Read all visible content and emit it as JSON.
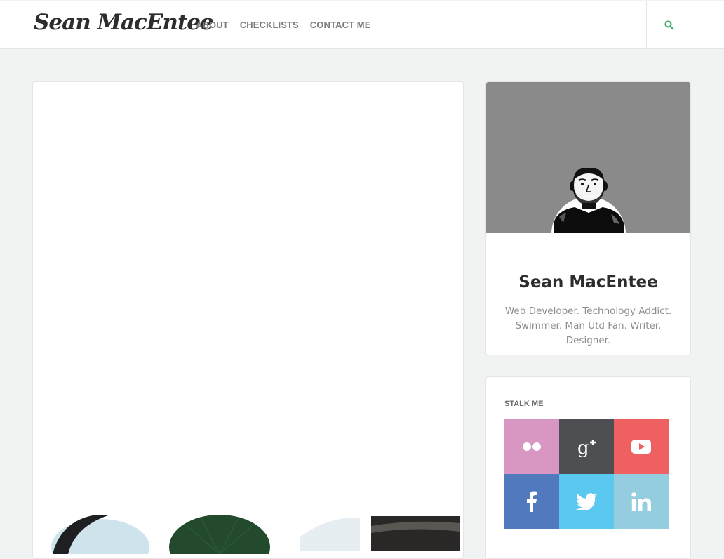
{
  "header": {
    "logo": "Sean MacEntee",
    "nav": [
      "ABOUT",
      "CHECKLISTS",
      "CONTACT ME"
    ],
    "search_icon": "search-icon"
  },
  "profile": {
    "name": "Sean MacEntee",
    "bio": "Web Developer. Technology Addict. Swimmer. Man Utd Fan. Writer. Designer."
  },
  "social": {
    "title": "STALK ME",
    "items": [
      {
        "name": "flickr",
        "icon": "flickr-icon",
        "color": "#d896c2"
      },
      {
        "name": "google-plus",
        "icon": "google-plus-icon",
        "color": "#4e4f53"
      },
      {
        "name": "youtube",
        "icon": "youtube-icon",
        "color": "#ef6161"
      },
      {
        "name": "facebook",
        "icon": "facebook-icon",
        "color": "#5079be"
      },
      {
        "name": "twitter",
        "icon": "twitter-icon",
        "color": "#5bc8ef"
      },
      {
        "name": "linkedin",
        "icon": "linkedin-icon",
        "color": "#95cde0"
      }
    ]
  },
  "colors": {
    "background": "#f1f2f2",
    "accent": "#3aa66a"
  }
}
